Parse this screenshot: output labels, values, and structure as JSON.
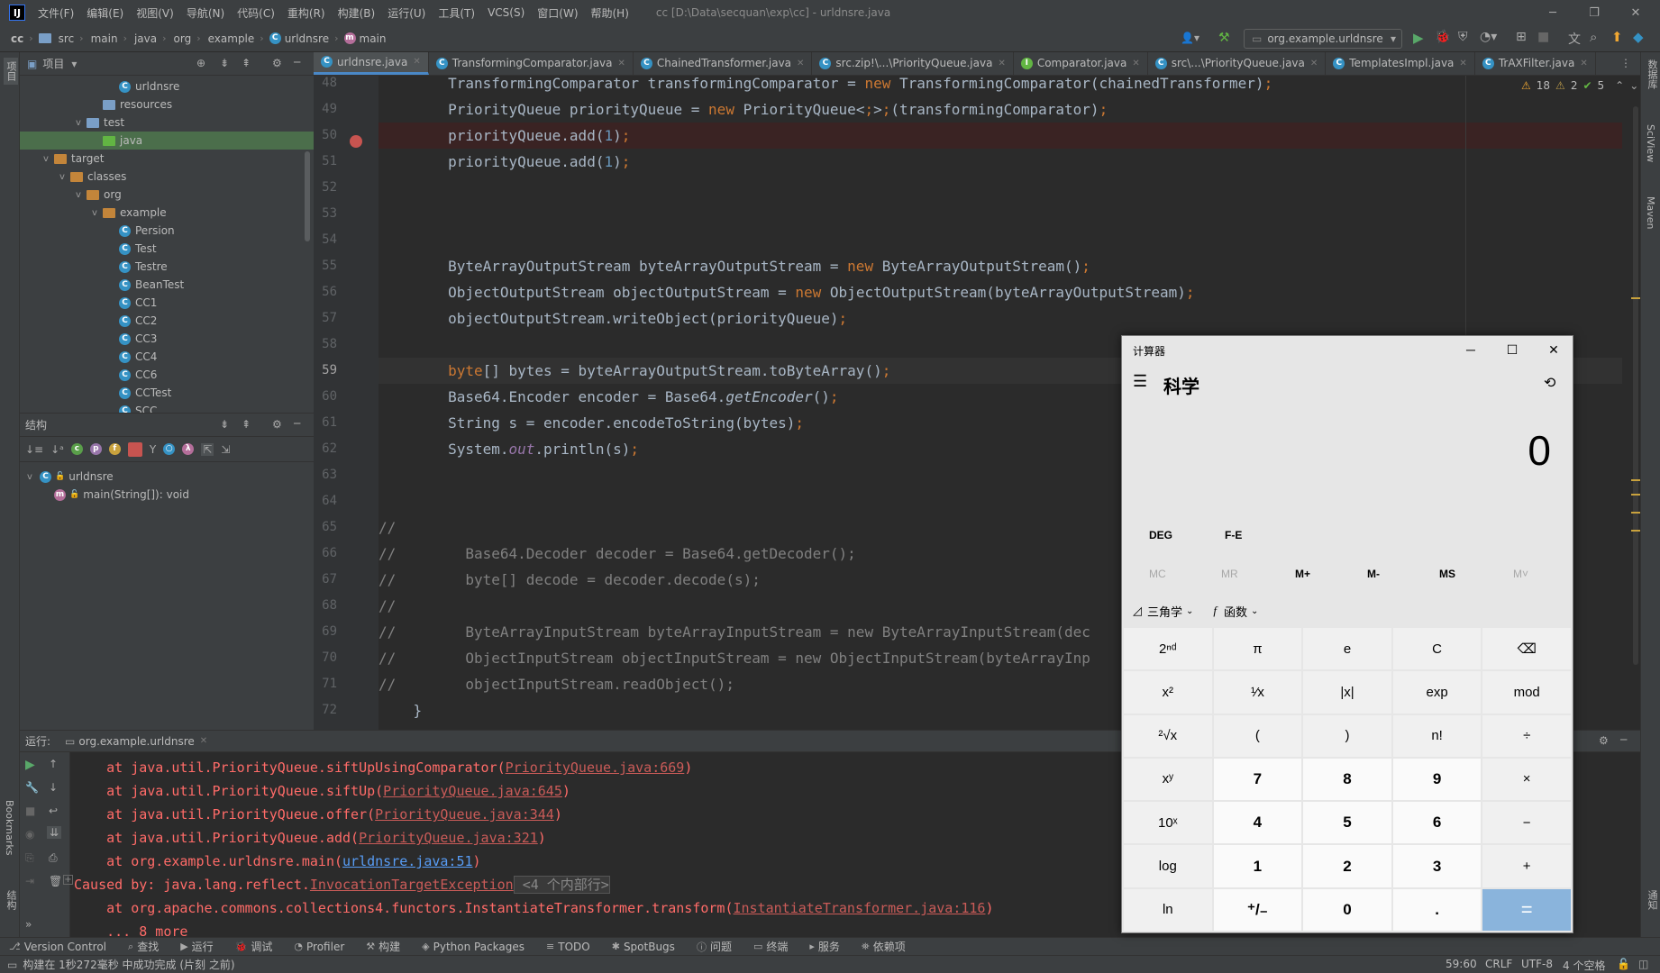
{
  "menubar": {
    "logo": "IJ",
    "items": [
      "文件(F)",
      "编辑(E)",
      "视图(V)",
      "导航(N)",
      "代码(C)",
      "重构(R)",
      "构建(B)",
      "运行(U)",
      "工具(T)",
      "VCS(S)",
      "窗口(W)",
      "帮助(H)"
    ],
    "window_title": "cc [D:\\Data\\secquan\\exp\\cc] - urldnsre.java"
  },
  "breadcrumb": [
    "cc",
    "src",
    "main",
    "java",
    "org",
    "example",
    "urldnsre",
    "main"
  ],
  "run_config": "org.example.urldnsre",
  "project_panel": {
    "title": "项目",
    "tree": [
      {
        "label": "urldnsre",
        "icon": "class",
        "indent": 5,
        "arrow": ""
      },
      {
        "label": "resources",
        "icon": "folder-res",
        "indent": 4,
        "arrow": ""
      },
      {
        "label": "test",
        "icon": "folder",
        "indent": 3,
        "arrow": "v"
      },
      {
        "label": "java",
        "icon": "folder-green",
        "indent": 4,
        "arrow": "",
        "selected": true
      },
      {
        "label": "target",
        "icon": "folder-orange",
        "indent": 1,
        "arrow": "v"
      },
      {
        "label": "classes",
        "icon": "folder-orange",
        "indent": 2,
        "arrow": "v"
      },
      {
        "label": "org",
        "icon": "folder-orange",
        "indent": 3,
        "arrow": "v"
      },
      {
        "label": "example",
        "icon": "folder-orange",
        "indent": 4,
        "arrow": "v"
      },
      {
        "label": "Persion",
        "icon": "class",
        "indent": 5,
        "arrow": ""
      },
      {
        "label": "Test",
        "icon": "class",
        "indent": 5,
        "arrow": ""
      },
      {
        "label": "Testre",
        "icon": "class",
        "indent": 5,
        "arrow": ""
      },
      {
        "label": "BeanTest",
        "icon": "class",
        "indent": 5,
        "arrow": ""
      },
      {
        "label": "CC1",
        "icon": "class",
        "indent": 5,
        "arrow": ""
      },
      {
        "label": "CC2",
        "icon": "class",
        "indent": 5,
        "arrow": ""
      },
      {
        "label": "CC3",
        "icon": "class",
        "indent": 5,
        "arrow": ""
      },
      {
        "label": "CC4",
        "icon": "class",
        "indent": 5,
        "arrow": ""
      },
      {
        "label": "CC6",
        "icon": "class",
        "indent": 5,
        "arrow": ""
      },
      {
        "label": "CCTest",
        "icon": "class",
        "indent": 5,
        "arrow": ""
      },
      {
        "label": "SCC",
        "icon": "class",
        "indent": 5,
        "arrow": ""
      }
    ]
  },
  "structure_panel": {
    "title": "结构",
    "class_name": "urldnsre",
    "method": "main(String[]): void"
  },
  "tabs": [
    {
      "label": "urldnsre.java",
      "active": true
    },
    {
      "label": "TransformingComparator.java"
    },
    {
      "label": "ChainedTransformer.java"
    },
    {
      "label": "src.zip!\\...\\PriorityQueue.java"
    },
    {
      "label": "Comparator.java"
    },
    {
      "label": "src\\...\\PriorityQueue.java"
    },
    {
      "label": "TemplatesImpl.java"
    },
    {
      "label": "TrAXFilter.java"
    }
  ],
  "inspections": {
    "warnings": "18",
    "weak": "2",
    "ok": "5"
  },
  "code_lines": [
    {
      "n": "48",
      "text": "        TransformingComparator transformingComparator = new TransformingComparator(chainedTransformer);"
    },
    {
      "n": "49",
      "text": "        PriorityQueue priorityQueue = new PriorityQueue<>(transformingComparator);"
    },
    {
      "n": "50",
      "text": "        priorityQueue.add(1);",
      "bp": true
    },
    {
      "n": "51",
      "text": "        priorityQueue.add(1);"
    },
    {
      "n": "52",
      "text": ""
    },
    {
      "n": "53",
      "text": ""
    },
    {
      "n": "54",
      "text": ""
    },
    {
      "n": "55",
      "text": "        ByteArrayOutputStream byteArrayOutputStream = new ByteArrayOutputStream();"
    },
    {
      "n": "56",
      "text": "        ObjectOutputStream objectOutputStream = new ObjectOutputStream(byteArrayOutputStream);"
    },
    {
      "n": "57",
      "text": "        objectOutputStream.writeObject(priorityQueue);"
    },
    {
      "n": "58",
      "text": ""
    },
    {
      "n": "59",
      "text": "        byte[] bytes = byteArrayOutputStream.toByteArray();",
      "cur": true
    },
    {
      "n": "60",
      "text": "        Base64.Encoder encoder = Base64.getEncoder();"
    },
    {
      "n": "61",
      "text": "        String s = encoder.encodeToString(bytes);"
    },
    {
      "n": "62",
      "text": "        System.out.println(s);"
    },
    {
      "n": "63",
      "text": ""
    },
    {
      "n": "64",
      "text": ""
    },
    {
      "n": "65",
      "text": "//"
    },
    {
      "n": "66",
      "text": "//        Base64.Decoder decoder = Base64.getDecoder();"
    },
    {
      "n": "67",
      "text": "//        byte[] decode = decoder.decode(s);"
    },
    {
      "n": "68",
      "text": "//"
    },
    {
      "n": "69",
      "text": "//        ByteArrayInputStream byteArrayInputStream = new ByteArrayInputStream(dec"
    },
    {
      "n": "70",
      "text": "//        ObjectInputStream objectInputStream = new ObjectInputStream(byteArrayInp"
    },
    {
      "n": "71",
      "text": "//        objectInputStream.readObject();"
    },
    {
      "n": "72",
      "text": "    }"
    }
  ],
  "run_panel": {
    "label": "运行:",
    "tab": "org.example.urldnsre",
    "output": [
      {
        "pre": "    at java.util.PriorityQueue.siftUpUsingComparator(",
        "link": "PriorityQueue.java:669",
        "post": ")"
      },
      {
        "pre": "    at java.util.PriorityQueue.siftUp(",
        "link": "PriorityQueue.java:645",
        "post": ")"
      },
      {
        "pre": "    at java.util.PriorityQueue.offer(",
        "link": "PriorityQueue.java:344",
        "post": ")"
      },
      {
        "pre": "    at java.util.PriorityQueue.add(",
        "link": "PriorityQueue.java:321",
        "post": ")"
      },
      {
        "pre": "    at org.example.urldnsre.main(",
        "link": "urldnsre.java:51",
        "post": ")",
        "blue": true
      },
      {
        "pre": "Caused by: java.lang.reflect.",
        "link": "InvocationTargetException",
        "post": " <4 个内部行>"
      },
      {
        "pre": "    at org.apache.commons.collections4.functors.InstantiateTransformer.transform(",
        "link": "InstantiateTransformer.java:116",
        "post": ")"
      },
      {
        "pre": "    ... 8 more",
        "link": "",
        "post": ""
      }
    ]
  },
  "tool_windows": [
    "Version Control",
    "查找",
    "运行",
    "调试",
    "Profiler",
    "构建",
    "Python Packages",
    "TODO",
    "SpotBugs",
    "问题",
    "终端",
    "服务",
    "依赖项"
  ],
  "status": {
    "message": "构建在 1秒272毫秒 中成功完成 (片刻 之前)",
    "position": "59:60",
    "line_sep": "CRLF",
    "encoding": "UTF-8",
    "indent": "4 个空格"
  },
  "left_strip": [
    "项目",
    "Bookmarks",
    "结构"
  ],
  "right_strip": [
    "数据库",
    "SciView",
    "Maven",
    "通知"
  ],
  "calculator": {
    "title": "计算器",
    "mode": "科学",
    "display": "0",
    "deg": "DEG",
    "fe": "F-E",
    "memory": [
      "MC",
      "MR",
      "M+",
      "M-",
      "MS",
      "M˅"
    ],
    "trig_label": "三角学",
    "func_label": "函数",
    "keys": [
      "2ⁿᵈ",
      "π",
      "e",
      "C",
      "⌫",
      "x²",
      "¹⁄x",
      "|x|",
      "exp",
      "mod",
      "²√x",
      "(",
      ")",
      "n!",
      "÷",
      "xʸ",
      "7",
      "8",
      "9",
      "×",
      "10ˣ",
      "4",
      "5",
      "6",
      "−",
      "log",
      "1",
      "2",
      "3",
      "+",
      "ln",
      "⁺/₋",
      "0",
      ".",
      "="
    ]
  }
}
